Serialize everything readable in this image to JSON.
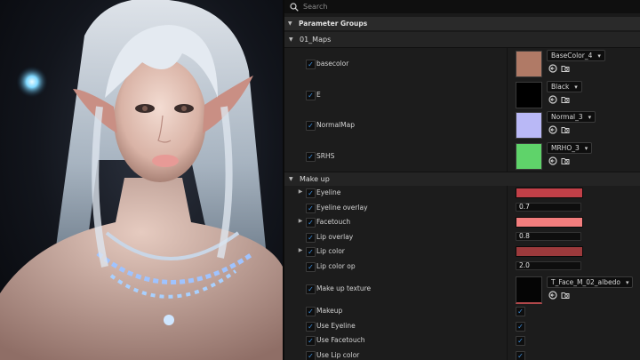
{
  "search": {
    "placeholder": "Search"
  },
  "parameter_groups": {
    "label": "Parameter Groups"
  },
  "maps": {
    "label": "01_Maps",
    "items": [
      {
        "label": "basecolor",
        "texture": "BaseColor_4",
        "preview_color": "#b07a66"
      },
      {
        "label": "E",
        "texture": "Black",
        "preview_color": "#000000"
      },
      {
        "label": "NormalMap",
        "texture": "Normal_3",
        "preview_color": "#b9b8f6"
      },
      {
        "label": "SRHS",
        "texture": "MRHO_3",
        "preview_color": "#5fd36a"
      }
    ]
  },
  "makeup": {
    "label": "Make up",
    "items": [
      {
        "label": "Eyeline",
        "kind": "color",
        "color": "#c24048"
      },
      {
        "label": "Eyeline overlay",
        "kind": "number",
        "value": "0.7"
      },
      {
        "label": "Facetouch",
        "kind": "color",
        "color": "#f37e7e"
      },
      {
        "label": "Lip  overlay",
        "kind": "number",
        "value": "0.8"
      },
      {
        "label": "Lip color",
        "kind": "color",
        "color": "#9c3a3c"
      },
      {
        "label": "Lip color op",
        "kind": "number",
        "value": "2.0"
      },
      {
        "label": "Make up texture",
        "kind": "texture",
        "texture": "T_Face_M_02_albedo",
        "preview_color": "#050505"
      },
      {
        "label": "Makeup",
        "kind": "bool",
        "checked": true
      },
      {
        "label": "Use Eyeline",
        "kind": "bool",
        "checked": true
      },
      {
        "label": "Use Facetouch",
        "kind": "bool",
        "checked": true
      },
      {
        "label": "Use Lip color",
        "kind": "bool",
        "checked": true
      }
    ]
  },
  "icons": {
    "search": "search-icon",
    "use_selected": "arrow-left-circle-icon",
    "browse": "folder-search-icon"
  },
  "colors": {
    "accent": "#3c8fe0",
    "panel_bg": "#1a1a1a",
    "group_bg": "#2a2a2a"
  }
}
